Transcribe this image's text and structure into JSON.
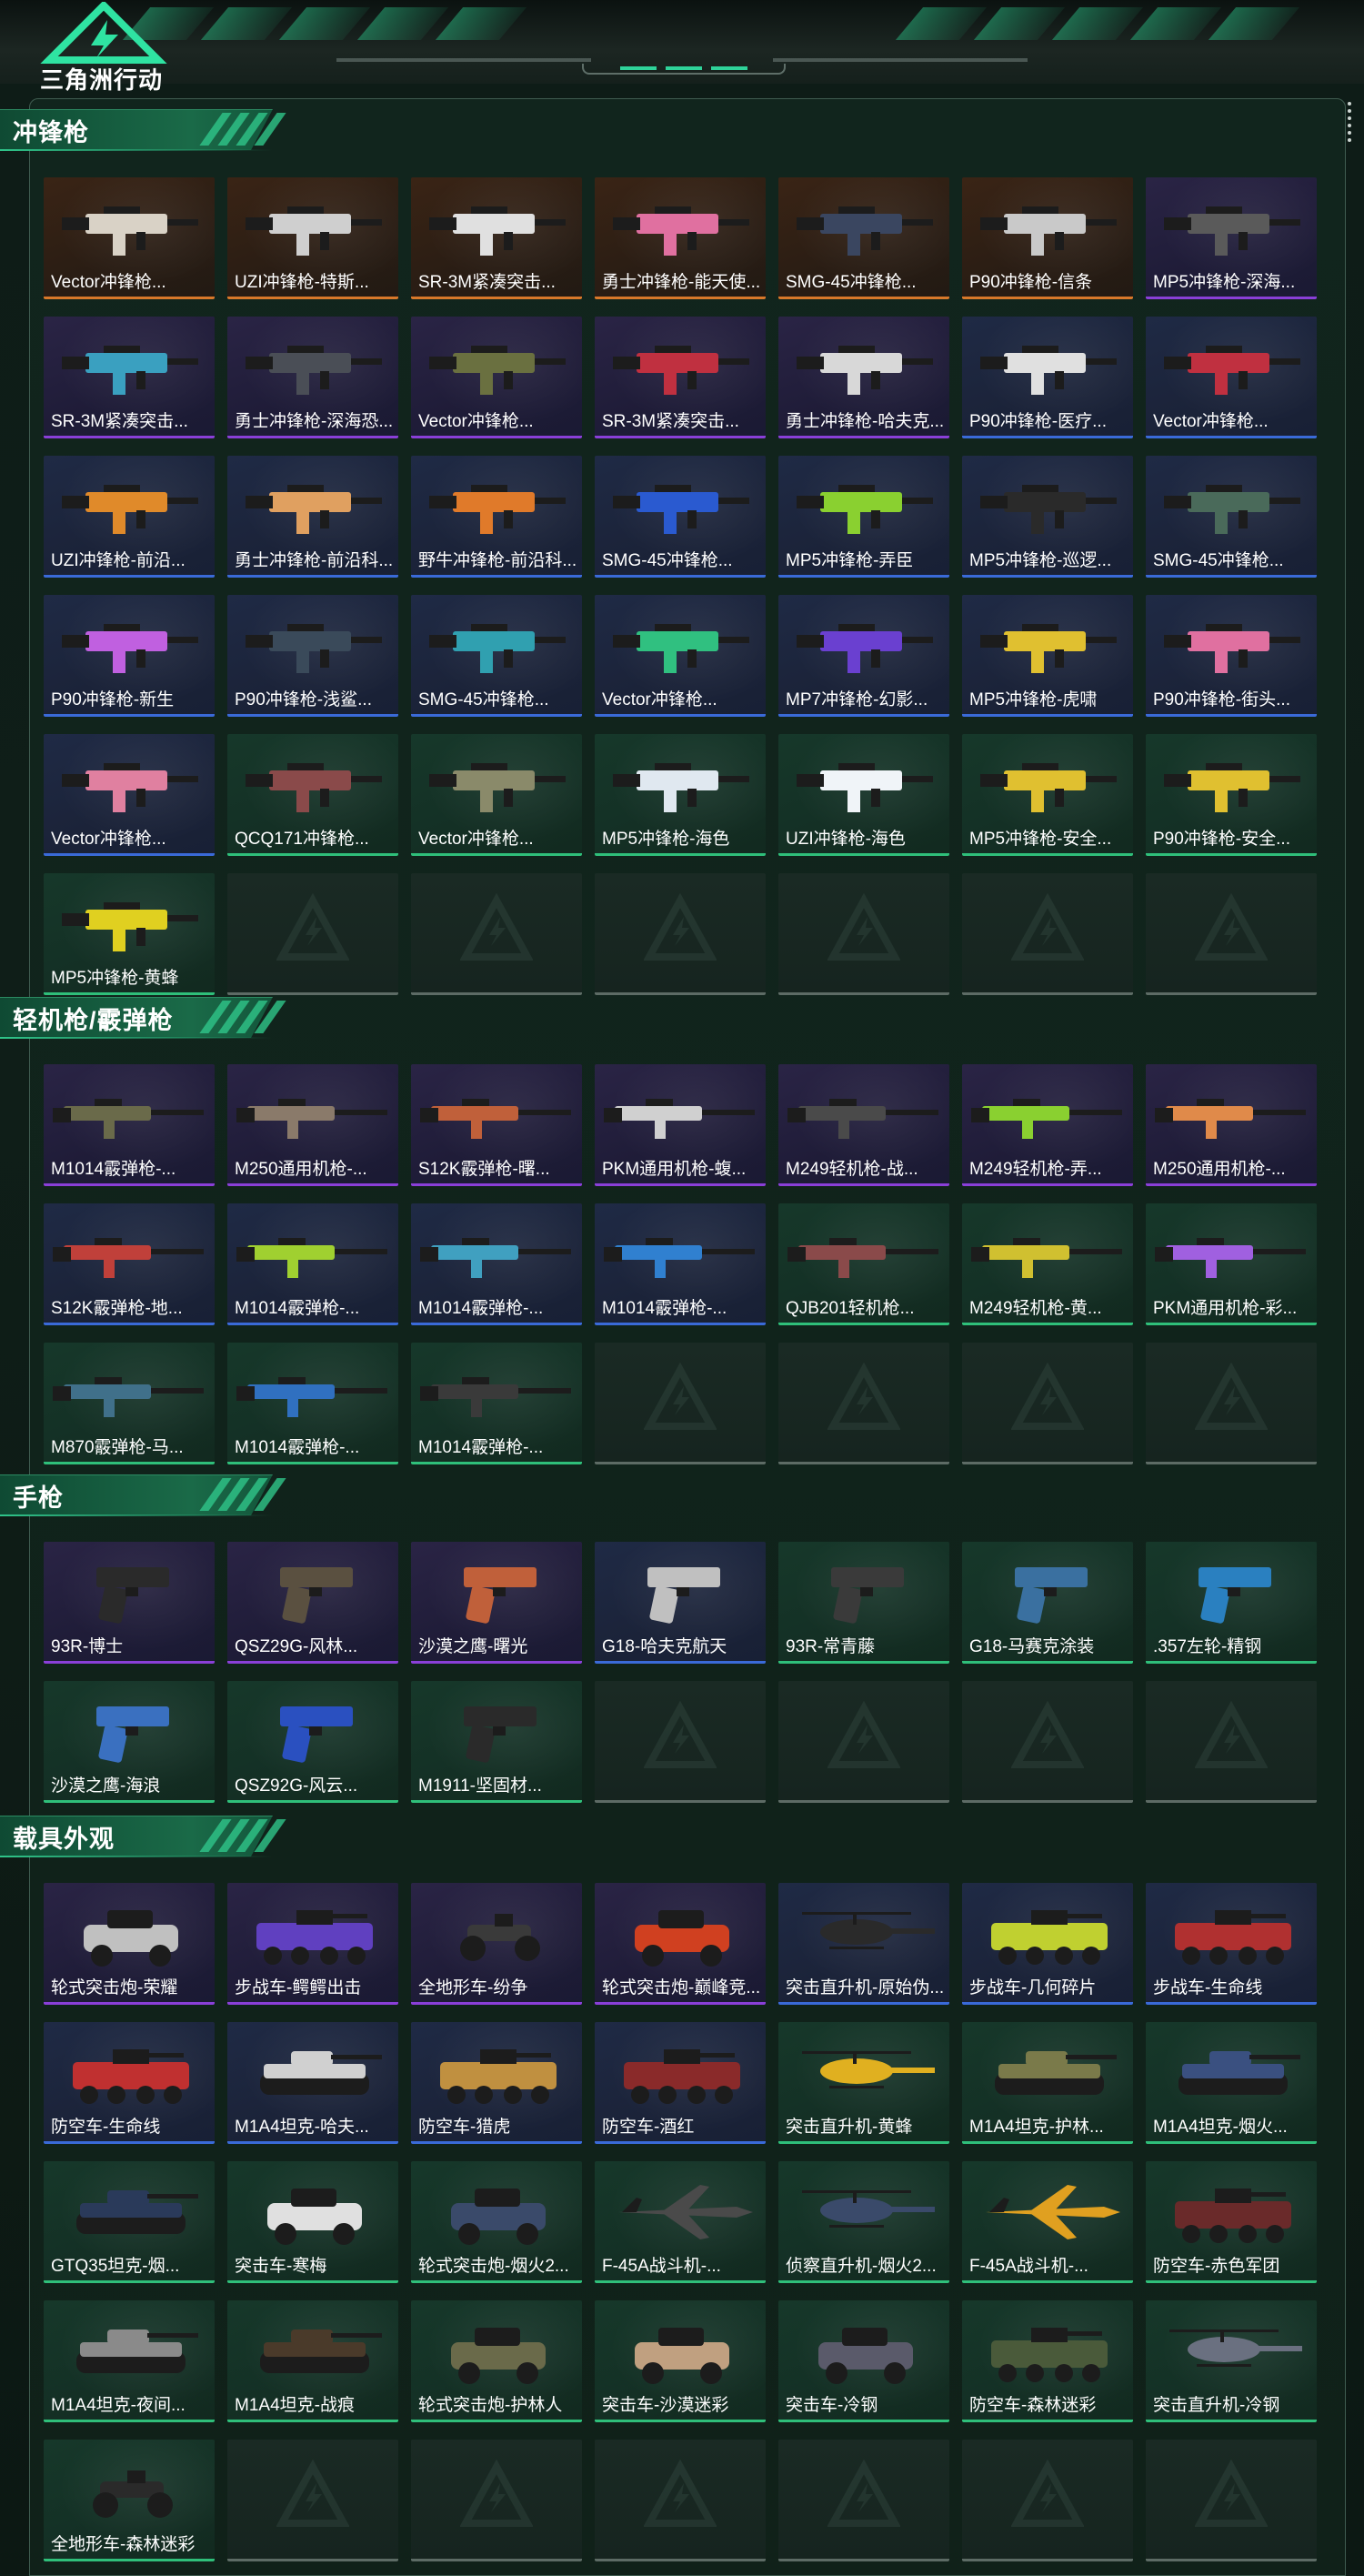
{
  "app": {
    "logo_text": "三角洲行动"
  },
  "colors": {
    "accent": "#2fc58a",
    "purple": "#8a3fd8",
    "orange": "#d8782a",
    "blue": "#3a6ad8",
    "green": "#2fbf7a",
    "empty": "#5d6b65"
  },
  "sections": [
    {
      "title": "冲锋枪",
      "items": [
        {
          "label": "Vector冲锋枪...",
          "rarity": "orange",
          "kind": "smg",
          "color": "#d9d2c6"
        },
        {
          "label": "UZI冲锋枪-特斯...",
          "rarity": "orange",
          "kind": "smg",
          "color": "#cfcfcf"
        },
        {
          "label": "SR-3M紧凑突击...",
          "rarity": "orange",
          "kind": "smg",
          "color": "#e0e0e0"
        },
        {
          "label": "勇士冲锋枪-能天使...",
          "rarity": "orange",
          "kind": "smg",
          "color": "#e070a0"
        },
        {
          "label": "SMG-45冲锋枪...",
          "rarity": "orange",
          "kind": "smg",
          "color": "#3a4660"
        },
        {
          "label": "P90冲锋枪-信条",
          "rarity": "orange",
          "kind": "smg",
          "color": "#c9c9c9"
        },
        {
          "label": "MP5冲锋枪-深海...",
          "rarity": "purple",
          "kind": "smg",
          "color": "#5a5a5a"
        },
        {
          "label": "SR-3M紧凑突击...",
          "rarity": "purple",
          "kind": "smg",
          "color": "#3aa0c0"
        },
        {
          "label": "勇士冲锋枪-深海恐...",
          "rarity": "purple",
          "kind": "smg",
          "color": "#4a4e56"
        },
        {
          "label": "Vector冲锋枪...",
          "rarity": "purple",
          "kind": "smg",
          "color": "#6a7040"
        },
        {
          "label": "SR-3M紧凑突击...",
          "rarity": "purple",
          "kind": "smg",
          "color": "#c03040"
        },
        {
          "label": "勇士冲锋枪-哈夫克...",
          "rarity": "purple",
          "kind": "smg",
          "color": "#d8d8d8"
        },
        {
          "label": "P90冲锋枪-医疗...",
          "rarity": "blue",
          "kind": "smg",
          "color": "#e0e0e0"
        },
        {
          "label": "Vector冲锋枪...",
          "rarity": "blue",
          "kind": "smg",
          "color": "#c03040"
        },
        {
          "label": "UZI冲锋枪-前沿...",
          "rarity": "blue",
          "kind": "smg",
          "color": "#e08a2a"
        },
        {
          "label": "勇士冲锋枪-前沿科...",
          "rarity": "blue",
          "kind": "smg",
          "color": "#e0a060"
        },
        {
          "label": "野牛冲锋枪-前沿科...",
          "rarity": "blue",
          "kind": "smg",
          "color": "#e07a2a"
        },
        {
          "label": "SMG-45冲锋枪...",
          "rarity": "blue",
          "kind": "smg",
          "color": "#2a5ad0"
        },
        {
          "label": "MP5冲锋枪-弄臣",
          "rarity": "blue",
          "kind": "smg",
          "color": "#8ad030"
        },
        {
          "label": "MP5冲锋枪-巡逻...",
          "rarity": "blue",
          "kind": "smg",
          "color": "#2a2a2a"
        },
        {
          "label": "SMG-45冲锋枪...",
          "rarity": "blue",
          "kind": "smg",
          "color": "#4a6a5a"
        },
        {
          "label": "P90冲锋枪-新生",
          "rarity": "blue",
          "kind": "smg",
          "color": "#c060e0"
        },
        {
          "label": "P90冲锋枪-浅鲨...",
          "rarity": "blue",
          "kind": "smg",
          "color": "#3a4a5a"
        },
        {
          "label": "SMG-45冲锋枪...",
          "rarity": "blue",
          "kind": "smg",
          "color": "#30a0b0"
        },
        {
          "label": "Vector冲锋枪...",
          "rarity": "blue",
          "kind": "smg",
          "color": "#30c080"
        },
        {
          "label": "MP7冲锋枪-幻影...",
          "rarity": "blue",
          "kind": "smg",
          "color": "#6a40d0"
        },
        {
          "label": "MP5冲锋枪-虎啸",
          "rarity": "blue",
          "kind": "smg",
          "color": "#e0c030"
        },
        {
          "label": "P90冲锋枪-街头...",
          "rarity": "blue",
          "kind": "smg",
          "color": "#e070a0"
        },
        {
          "label": "Vector冲锋枪...",
          "rarity": "blue",
          "kind": "smg",
          "color": "#e080a0"
        },
        {
          "label": "QCQ171冲锋枪...",
          "rarity": "green",
          "kind": "smg",
          "color": "#8a4a4a"
        },
        {
          "label": "Vector冲锋枪...",
          "rarity": "green",
          "kind": "smg",
          "color": "#8a8a6a"
        },
        {
          "label": "MP5冲锋枪-海色",
          "rarity": "green",
          "kind": "smg",
          "color": "#e0e8f0"
        },
        {
          "label": "UZI冲锋枪-海色",
          "rarity": "green",
          "kind": "smg",
          "color": "#f0f4f8"
        },
        {
          "label": "MP5冲锋枪-安全...",
          "rarity": "green",
          "kind": "smg",
          "color": "#e0c030"
        },
        {
          "label": "P90冲锋枪-安全...",
          "rarity": "green",
          "kind": "smg",
          "color": "#e0c030"
        },
        {
          "label": "MP5冲锋枪-黄蜂",
          "rarity": "green",
          "kind": "smg",
          "color": "#e0d020"
        },
        {
          "label": "",
          "rarity": "empty",
          "kind": "empty",
          "color": ""
        },
        {
          "label": "",
          "rarity": "empty",
          "kind": "empty",
          "color": ""
        },
        {
          "label": "",
          "rarity": "empty",
          "kind": "empty",
          "color": ""
        },
        {
          "label": "",
          "rarity": "empty",
          "kind": "empty",
          "color": ""
        },
        {
          "label": "",
          "rarity": "empty",
          "kind": "empty",
          "color": ""
        },
        {
          "label": "",
          "rarity": "empty",
          "kind": "empty",
          "color": ""
        }
      ]
    },
    {
      "title": "轻机枪/霰弹枪",
      "items": [
        {
          "label": "M1014霰弹枪-...",
          "rarity": "purple",
          "kind": "long",
          "color": "#6a6a4a"
        },
        {
          "label": "M250通用机枪-...",
          "rarity": "purple",
          "kind": "long",
          "color": "#8a7a6a"
        },
        {
          "label": "S12K霰弹枪-曙...",
          "rarity": "purple",
          "kind": "long",
          "color": "#c0603a"
        },
        {
          "label": "PKM通用机枪-蝮...",
          "rarity": "purple",
          "kind": "long",
          "color": "#d0d0d0"
        },
        {
          "label": "M249轻机枪-战...",
          "rarity": "purple",
          "kind": "long",
          "color": "#4a4a4a"
        },
        {
          "label": "M249轻机枪-弄...",
          "rarity": "purple",
          "kind": "long",
          "color": "#8ad030"
        },
        {
          "label": "M250通用机枪-...",
          "rarity": "purple",
          "kind": "long",
          "color": "#e08a4a"
        },
        {
          "label": "S12K霰弹枪-地...",
          "rarity": "blue",
          "kind": "long",
          "color": "#c0403a"
        },
        {
          "label": "M1014霰弹枪-...",
          "rarity": "blue",
          "kind": "long",
          "color": "#a0d030"
        },
        {
          "label": "M1014霰弹枪-...",
          "rarity": "blue",
          "kind": "long",
          "color": "#40a0c0"
        },
        {
          "label": "M1014霰弹枪-...",
          "rarity": "blue",
          "kind": "long",
          "color": "#3080d0"
        },
        {
          "label": "QJB201轻机枪...",
          "rarity": "green",
          "kind": "long",
          "color": "#8a4a4a"
        },
        {
          "label": "M249轻机枪-黄...",
          "rarity": "green",
          "kind": "long",
          "color": "#d0c030"
        },
        {
          "label": "PKM通用机枪-彩...",
          "rarity": "green",
          "kind": "long",
          "color": "#a060e0"
        },
        {
          "label": "M870霰弹枪-马...",
          "rarity": "green",
          "kind": "long",
          "color": "#40708a"
        },
        {
          "label": "M1014霰弹枪-...",
          "rarity": "green",
          "kind": "long",
          "color": "#3070c0"
        },
        {
          "label": "M1014霰弹枪-...",
          "rarity": "green",
          "kind": "long",
          "color": "#3a3a3a"
        },
        {
          "label": "",
          "rarity": "empty",
          "kind": "empty",
          "color": ""
        },
        {
          "label": "",
          "rarity": "empty",
          "kind": "empty",
          "color": ""
        },
        {
          "label": "",
          "rarity": "empty",
          "kind": "empty",
          "color": ""
        },
        {
          "label": "",
          "rarity": "empty",
          "kind": "empty",
          "color": ""
        }
      ]
    },
    {
      "title": "手枪",
      "items": [
        {
          "label": "93R-博士",
          "rarity": "purple",
          "kind": "pistol",
          "color": "#2a2a2a"
        },
        {
          "label": "QSZ29G-风林...",
          "rarity": "purple",
          "kind": "pistol",
          "color": "#5a5040"
        },
        {
          "label": "沙漠之鹰-曙光",
          "rarity": "purple",
          "kind": "pistol",
          "color": "#c0603a"
        },
        {
          "label": "G18-哈夫克航天",
          "rarity": "blue",
          "kind": "pistol",
          "color": "#c0c0c0"
        },
        {
          "label": "93R-常青藤",
          "rarity": "green",
          "kind": "pistol",
          "color": "#3a3a3a"
        },
        {
          "label": "G18-马赛克涂装",
          "rarity": "green",
          "kind": "pistol",
          "color": "#3a70a0"
        },
        {
          "label": ".357左轮-精钢",
          "rarity": "green",
          "kind": "pistol",
          "color": "#2a80c0"
        },
        {
          "label": "沙漠之鹰-海浪",
          "rarity": "green",
          "kind": "pistol",
          "color": "#3a70c0"
        },
        {
          "label": "QSZ92G-风云...",
          "rarity": "green",
          "kind": "pistol",
          "color": "#2a50c0"
        },
        {
          "label": "M1911-坚固材...",
          "rarity": "green",
          "kind": "pistol",
          "color": "#2a2a2a"
        },
        {
          "label": "",
          "rarity": "empty",
          "kind": "empty",
          "color": ""
        },
        {
          "label": "",
          "rarity": "empty",
          "kind": "empty",
          "color": ""
        },
        {
          "label": "",
          "rarity": "empty",
          "kind": "empty",
          "color": ""
        },
        {
          "label": "",
          "rarity": "empty",
          "kind": "empty",
          "color": ""
        }
      ]
    },
    {
      "title": "载具外观",
      "items": [
        {
          "label": "轮式突击炮-荣耀",
          "rarity": "purple",
          "kind": "car",
          "color": "#c0c0c0"
        },
        {
          "label": "步战车-鳄鳄出击",
          "rarity": "purple",
          "kind": "apc",
          "color": "#6040c0"
        },
        {
          "label": "全地形车-纷争",
          "rarity": "purple",
          "kind": "atv",
          "color": "#3a3a3a"
        },
        {
          "label": "轮式突击炮-巅峰竞...",
          "rarity": "purple",
          "kind": "car",
          "color": "#d04020"
        },
        {
          "label": "突击直升机-原始伪...",
          "rarity": "blue",
          "kind": "heli",
          "color": "#2a2a2a"
        },
        {
          "label": "步战车-几何碎片",
          "rarity": "blue",
          "kind": "apc",
          "color": "#c0d030"
        },
        {
          "label": "步战车-生命线",
          "rarity": "blue",
          "kind": "apc",
          "color": "#b03030"
        },
        {
          "label": "防空车-生命线",
          "rarity": "blue",
          "kind": "apc",
          "color": "#c03030"
        },
        {
          "label": "M1A4坦克-哈夫...",
          "rarity": "blue",
          "kind": "tank",
          "color": "#d0d0d0"
        },
        {
          "label": "防空车-猎虎",
          "rarity": "blue",
          "kind": "apc",
          "color": "#c09040"
        },
        {
          "label": "防空车-酒红",
          "rarity": "blue",
          "kind": "apc",
          "color": "#8a2a2a"
        },
        {
          "label": "突击直升机-黄蜂",
          "rarity": "green",
          "kind": "heli",
          "color": "#e0b020"
        },
        {
          "label": "M1A4坦克-护林...",
          "rarity": "green",
          "kind": "tank",
          "color": "#7a7a4a"
        },
        {
          "label": "M1A4坦克-烟火...",
          "rarity": "green",
          "kind": "tank",
          "color": "#3a5080"
        },
        {
          "label": "GTQ35坦克-烟...",
          "rarity": "green",
          "kind": "tank",
          "color": "#2a3a5a"
        },
        {
          "label": "突击车-寒梅",
          "rarity": "green",
          "kind": "car",
          "color": "#e0e0e0"
        },
        {
          "label": "轮式突击炮-烟火2...",
          "rarity": "green",
          "kind": "car",
          "color": "#3a4a6a"
        },
        {
          "label": "F-45A战斗机-...",
          "rarity": "green",
          "kind": "jet",
          "color": "#4a4a4a"
        },
        {
          "label": "侦察直升机-烟火2...",
          "rarity": "green",
          "kind": "heli",
          "color": "#3a4a6a"
        },
        {
          "label": "F-45A战斗机-...",
          "rarity": "green",
          "kind": "jet",
          "color": "#e0a020"
        },
        {
          "label": "防空车-赤色军团",
          "rarity": "green",
          "kind": "apc",
          "color": "#6a2a2a"
        },
        {
          "label": "M1A4坦克-夜间...",
          "rarity": "green",
          "kind": "tank",
          "color": "#8a8a8a"
        },
        {
          "label": "M1A4坦克-战痕",
          "rarity": "green",
          "kind": "tank",
          "color": "#4a3a2a"
        },
        {
          "label": "轮式突击炮-护林人",
          "rarity": "green",
          "kind": "car",
          "color": "#6a6a4a"
        },
        {
          "label": "突击车-沙漠迷彩",
          "rarity": "green",
          "kind": "car",
          "color": "#c0a080"
        },
        {
          "label": "突击车-冷钢",
          "rarity": "green",
          "kind": "car",
          "color": "#5a5a6a"
        },
        {
          "label": "防空车-森林迷彩",
          "rarity": "green",
          "kind": "apc",
          "color": "#4a5a3a"
        },
        {
          "label": "突击直升机-冷钢",
          "rarity": "green",
          "kind": "heli",
          "color": "#6a7080"
        },
        {
          "label": "全地形车-森林迷彩",
          "rarity": "green",
          "kind": "atv",
          "color": "#2a2a2a"
        },
        {
          "label": "",
          "rarity": "empty",
          "kind": "empty",
          "color": ""
        },
        {
          "label": "",
          "rarity": "empty",
          "kind": "empty",
          "color": ""
        },
        {
          "label": "",
          "rarity": "empty",
          "kind": "empty",
          "color": ""
        },
        {
          "label": "",
          "rarity": "empty",
          "kind": "empty",
          "color": ""
        },
        {
          "label": "",
          "rarity": "empty",
          "kind": "empty",
          "color": ""
        },
        {
          "label": "",
          "rarity": "empty",
          "kind": "empty",
          "color": ""
        }
      ]
    }
  ]
}
